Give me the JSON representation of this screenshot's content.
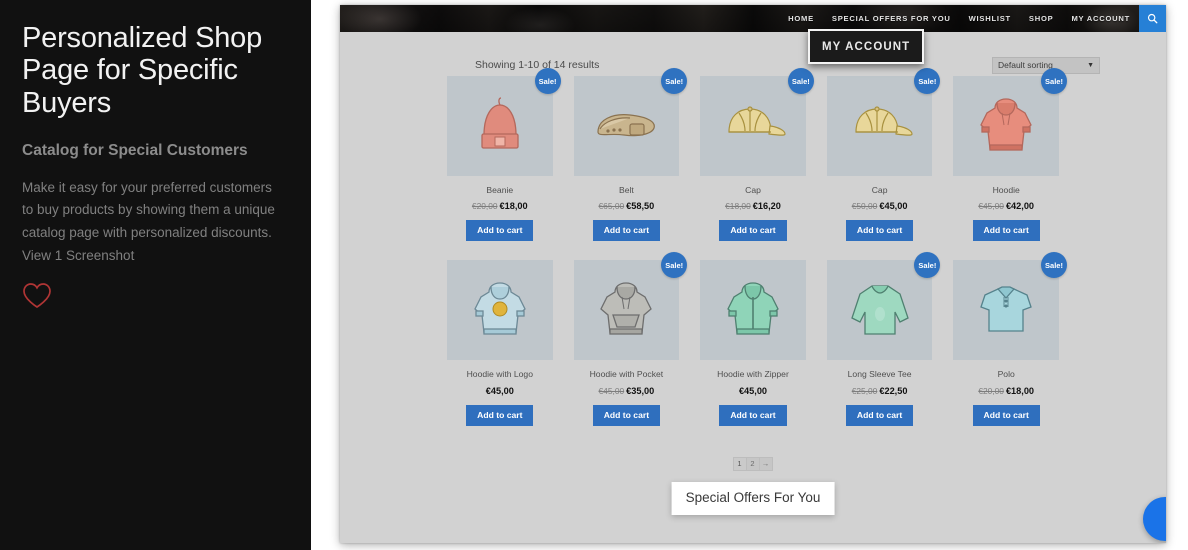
{
  "sidebar": {
    "title": "Personalized Shop Page for Specific Buyers",
    "subtitle": "Catalog for Special Customers",
    "description": "Make it easy for your preferred customers to buy products by showing them a unique catalog page with personalized discounts. View 1 Screenshot",
    "favorite_icon": "heart-icon",
    "accent_color": "#b03535"
  },
  "screenshot": {
    "nav": {
      "items": [
        {
          "label": "HOME"
        },
        {
          "label": "SPECIAL OFFERS FOR YOU"
        },
        {
          "label": "WISHLIST"
        },
        {
          "label": "SHOP"
        },
        {
          "label": "MY ACCOUNT"
        }
      ],
      "search_icon": "search-icon",
      "search_bg": "#2680d6"
    },
    "tooltip_account": "MY ACCOUNT",
    "tooltip_offers": "Special Offers For You",
    "toolbar": {
      "results": "Showing 1-10 of 14 results",
      "sort_value": "Default sorting",
      "sort_caret": "▼"
    },
    "sale_label": "Sale!",
    "cart_label": "Add to cart",
    "products": [
      {
        "name": "Beanie",
        "old_price": "€20,00",
        "price": "€18,00",
        "on_sale": true,
        "icon": "beanie-icon"
      },
      {
        "name": "Belt",
        "old_price": "€65,00",
        "price": "€58,50",
        "on_sale": true,
        "icon": "belt-icon"
      },
      {
        "name": "Cap",
        "old_price": "€18,00",
        "price": "€16,20",
        "on_sale": true,
        "icon": "cap-icon"
      },
      {
        "name": "Cap",
        "old_price": "€50,00",
        "price": "€45,00",
        "on_sale": true,
        "icon": "cap-icon"
      },
      {
        "name": "Hoodie",
        "old_price": "€45,00",
        "price": "€42,00",
        "on_sale": true,
        "icon": "hoodie-icon"
      },
      {
        "name": "Hoodie with Logo",
        "old_price": "",
        "price": "€45,00",
        "on_sale": false,
        "icon": "hoodie-logo-icon"
      },
      {
        "name": "Hoodie with Pocket",
        "old_price": "€45,00",
        "price": "€35,00",
        "on_sale": true,
        "icon": "hoodie-pocket-icon"
      },
      {
        "name": "Hoodie with Zipper",
        "old_price": "",
        "price": "€45,00",
        "on_sale": false,
        "icon": "hoodie-zipper-icon"
      },
      {
        "name": "Long Sleeve Tee",
        "old_price": "€25,00",
        "price": "€22,50",
        "on_sale": true,
        "icon": "longsleeve-icon"
      },
      {
        "name": "Polo",
        "old_price": "€20,00",
        "price": "€18,00",
        "on_sale": true,
        "icon": "polo-icon"
      }
    ],
    "pagination": [
      {
        "label": "1",
        "current": true
      },
      {
        "label": "2",
        "current": false
      },
      {
        "label": "→",
        "current": false
      }
    ],
    "chat_widget_color": "#1a73e8"
  }
}
